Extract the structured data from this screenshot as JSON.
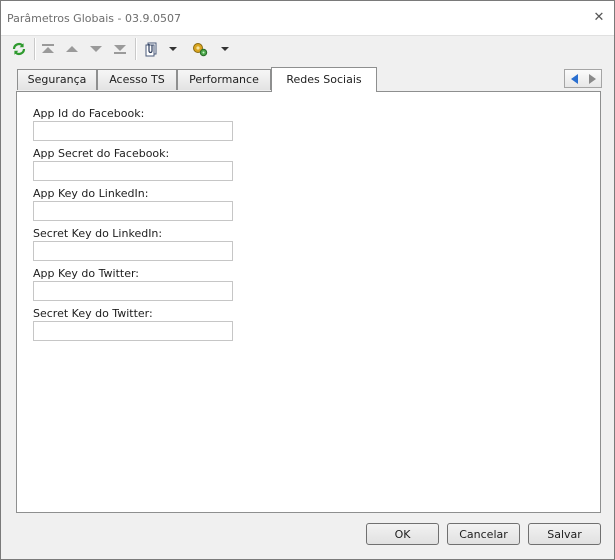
{
  "window": {
    "title": "Parâmetros Globais - 03.9.0507",
    "close_icon": "close-icon"
  },
  "toolbar": {
    "buttons": [
      {
        "name": "refresh-icon"
      },
      {
        "name": "first-record-icon"
      },
      {
        "name": "previous-record-icon"
      },
      {
        "name": "next-record-icon"
      },
      {
        "name": "last-record-icon"
      },
      {
        "name": "attachment-icon"
      },
      {
        "name": "attachment-dropdown-icon"
      },
      {
        "name": "tools-icon"
      },
      {
        "name": "tools-dropdown-icon"
      }
    ]
  },
  "tabs": [
    {
      "label": "Segurança",
      "active": false
    },
    {
      "label": "Acesso TS",
      "active": false
    },
    {
      "label": "Performance",
      "active": false
    },
    {
      "label": "Redes Sociais",
      "active": true
    }
  ],
  "fields": [
    {
      "label": "App Id do Facebook:",
      "value": ""
    },
    {
      "label": "App Secret do Facebook:",
      "value": ""
    },
    {
      "label": "App Key do LinkedIn:",
      "value": ""
    },
    {
      "label": "Secret Key do LinkedIn:",
      "value": ""
    },
    {
      "label": "App Key do Twitter:",
      "value": ""
    },
    {
      "label": "Secret Key do Twitter:",
      "value": ""
    }
  ],
  "footer": {
    "ok": "OK",
    "cancel": "Cancelar",
    "save": "Salvar"
  },
  "colors": {
    "refresh_green": "#2e9a2e",
    "nav_gray": "#9a9a9a",
    "scroll_blue": "#2a6fd0"
  }
}
